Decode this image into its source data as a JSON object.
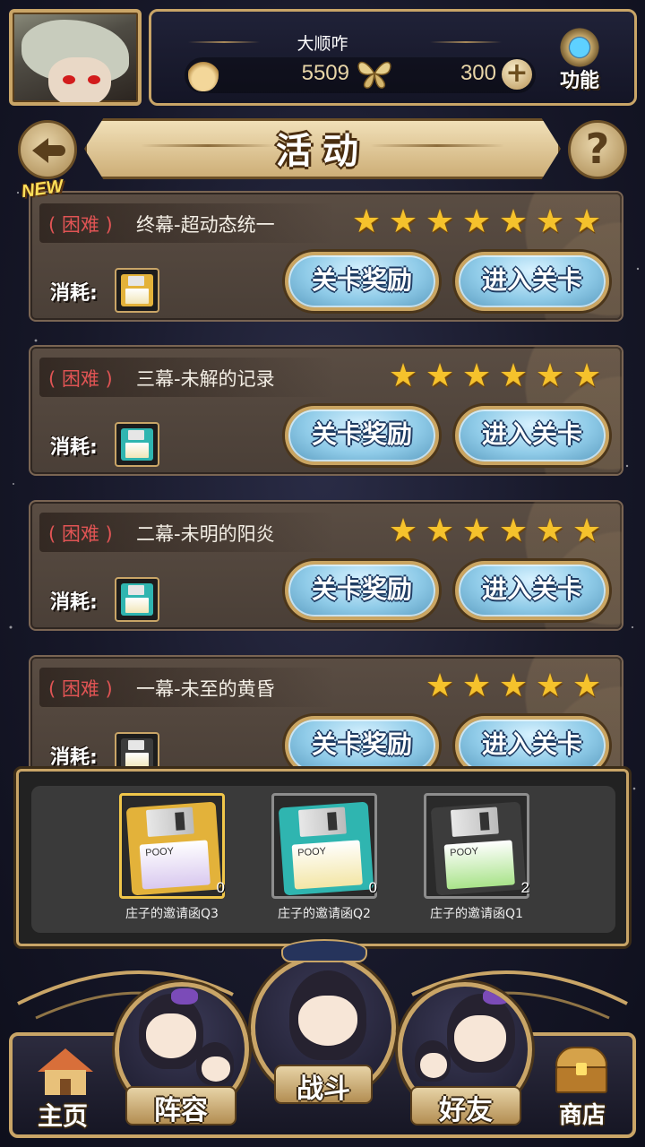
{
  "player": {
    "name": "大顺咋",
    "gold": "5509",
    "gems": "300"
  },
  "header": {
    "function_label": "功能",
    "title": "活动",
    "help_symbol": "?"
  },
  "new_badge": "NEW",
  "cost_label": "消耗:",
  "buttons": {
    "reward": "关卡奖励",
    "enter": "进入关卡"
  },
  "levels": [
    {
      "difficulty": "( 困难 )",
      "name": "终幕-超动态统一",
      "stars": 7,
      "cost_item": "gold"
    },
    {
      "difficulty": "( 困难 )",
      "name": "三幕-未解的记录",
      "stars": 6,
      "cost_item": "teal"
    },
    {
      "difficulty": "( 困难 )",
      "name": "二幕-未明的阳炎",
      "stars": 6,
      "cost_item": "teal"
    },
    {
      "difficulty": "( 困难 )",
      "name": "一幕-未至的黄昏",
      "stars": 5,
      "cost_item": "black"
    }
  ],
  "inventory": [
    {
      "name": "庄子的邀请函Q3",
      "count": "0",
      "color": "gold",
      "label_text": "POOY"
    },
    {
      "name": "庄子的邀请函Q2",
      "count": "0",
      "color": "teal",
      "label_text": "POOY"
    },
    {
      "name": "庄子的邀请函Q1",
      "count": "2",
      "color": "black",
      "label_text": "POOY"
    }
  ],
  "nav": {
    "home": "主页",
    "team": "阵容",
    "battle": "战斗",
    "friends": "好友",
    "shop": "商店"
  },
  "colors": {
    "frame_gold": "#c9a567",
    "difficulty_red": "#e05454",
    "star_yellow": "#f5c22c",
    "button_blue": "#8fcbe8",
    "floppy_gold": "#e3b23a",
    "floppy_teal": "#2fb5b0",
    "floppy_black": "#3c3c3c"
  },
  "icons": {
    "currency_1": "flame-icon",
    "currency_2": "butterfly-icon",
    "add": "plus-icon",
    "function": "gear-icon",
    "back": "back-arrow-icon",
    "help": "question-icon",
    "star": "star-icon",
    "home": "house-icon",
    "shop": "treasure-chest-icon"
  }
}
